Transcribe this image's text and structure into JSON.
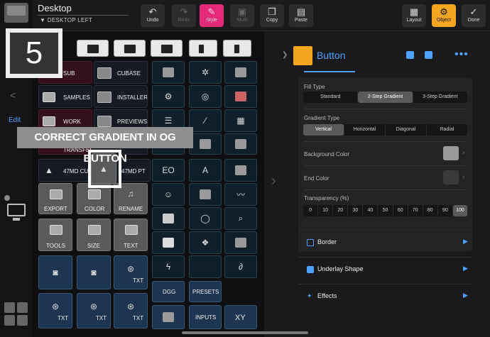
{
  "window": {
    "title": "Desktop",
    "subtitle": "▼ DESKTOP LEFT"
  },
  "toolbar": {
    "undo": "Undo",
    "redo": "Redo",
    "style": "Style",
    "multi": "Multi",
    "copy": "Copy",
    "paste": "Paste",
    "layout": "Layout",
    "object": "Object",
    "done": "Done"
  },
  "rail": {
    "back": "<",
    "edit": "Edit"
  },
  "annotation": {
    "step": "5",
    "callout": "CORRECT GRADIENT IN OG BUTTON"
  },
  "tiles": {
    "sub": "SUB",
    "cubase": "CUBASE",
    "samples": "SAMPLES",
    "installers": "INSTALLERS",
    "work": "WORK",
    "previews": "PREVIEWS",
    "transfer": "TRANSFER",
    "cub": "47MD CUB",
    "pt": "47MD PT",
    "export": "EXPORT",
    "color": "COLOR",
    "rename": "RENAME",
    "tools": "TOOLS",
    "size": "SIZE",
    "text": "TEXT",
    "txt": "TXT",
    "dgg": "DGG",
    "presets": "PRESETS",
    "inputs": "INPUTS",
    "xy": "XY"
  },
  "panel": {
    "object_name": "Button",
    "fill_type": {
      "label": "Fill Type",
      "options": [
        "Standard",
        "2-Step Gradient",
        "3-Step Gradient"
      ],
      "selected": "2-Step Gradient"
    },
    "gradient_type": {
      "label": "Gradient Type",
      "options": [
        "Vertical",
        "Horizontal",
        "Diagonal",
        "Radial"
      ],
      "selected": "Vertical"
    },
    "background_color": {
      "label": "Background Color",
      "value": "#9a9a9a"
    },
    "end_color": {
      "label": "End Color",
      "value": "#3a3a3c"
    },
    "transparency": {
      "label": "Transparency (%)",
      "options": [
        "0",
        "10",
        "20",
        "30",
        "40",
        "50",
        "60",
        "70",
        "80",
        "90",
        "100"
      ],
      "selected": "100"
    },
    "sections": [
      {
        "label": "Border"
      },
      {
        "label": "Underlay Shape"
      },
      {
        "label": "Effects"
      }
    ]
  },
  "colors": {
    "accent": "#4ea1ff",
    "object": "#f4a621",
    "style": "#e7297a"
  }
}
